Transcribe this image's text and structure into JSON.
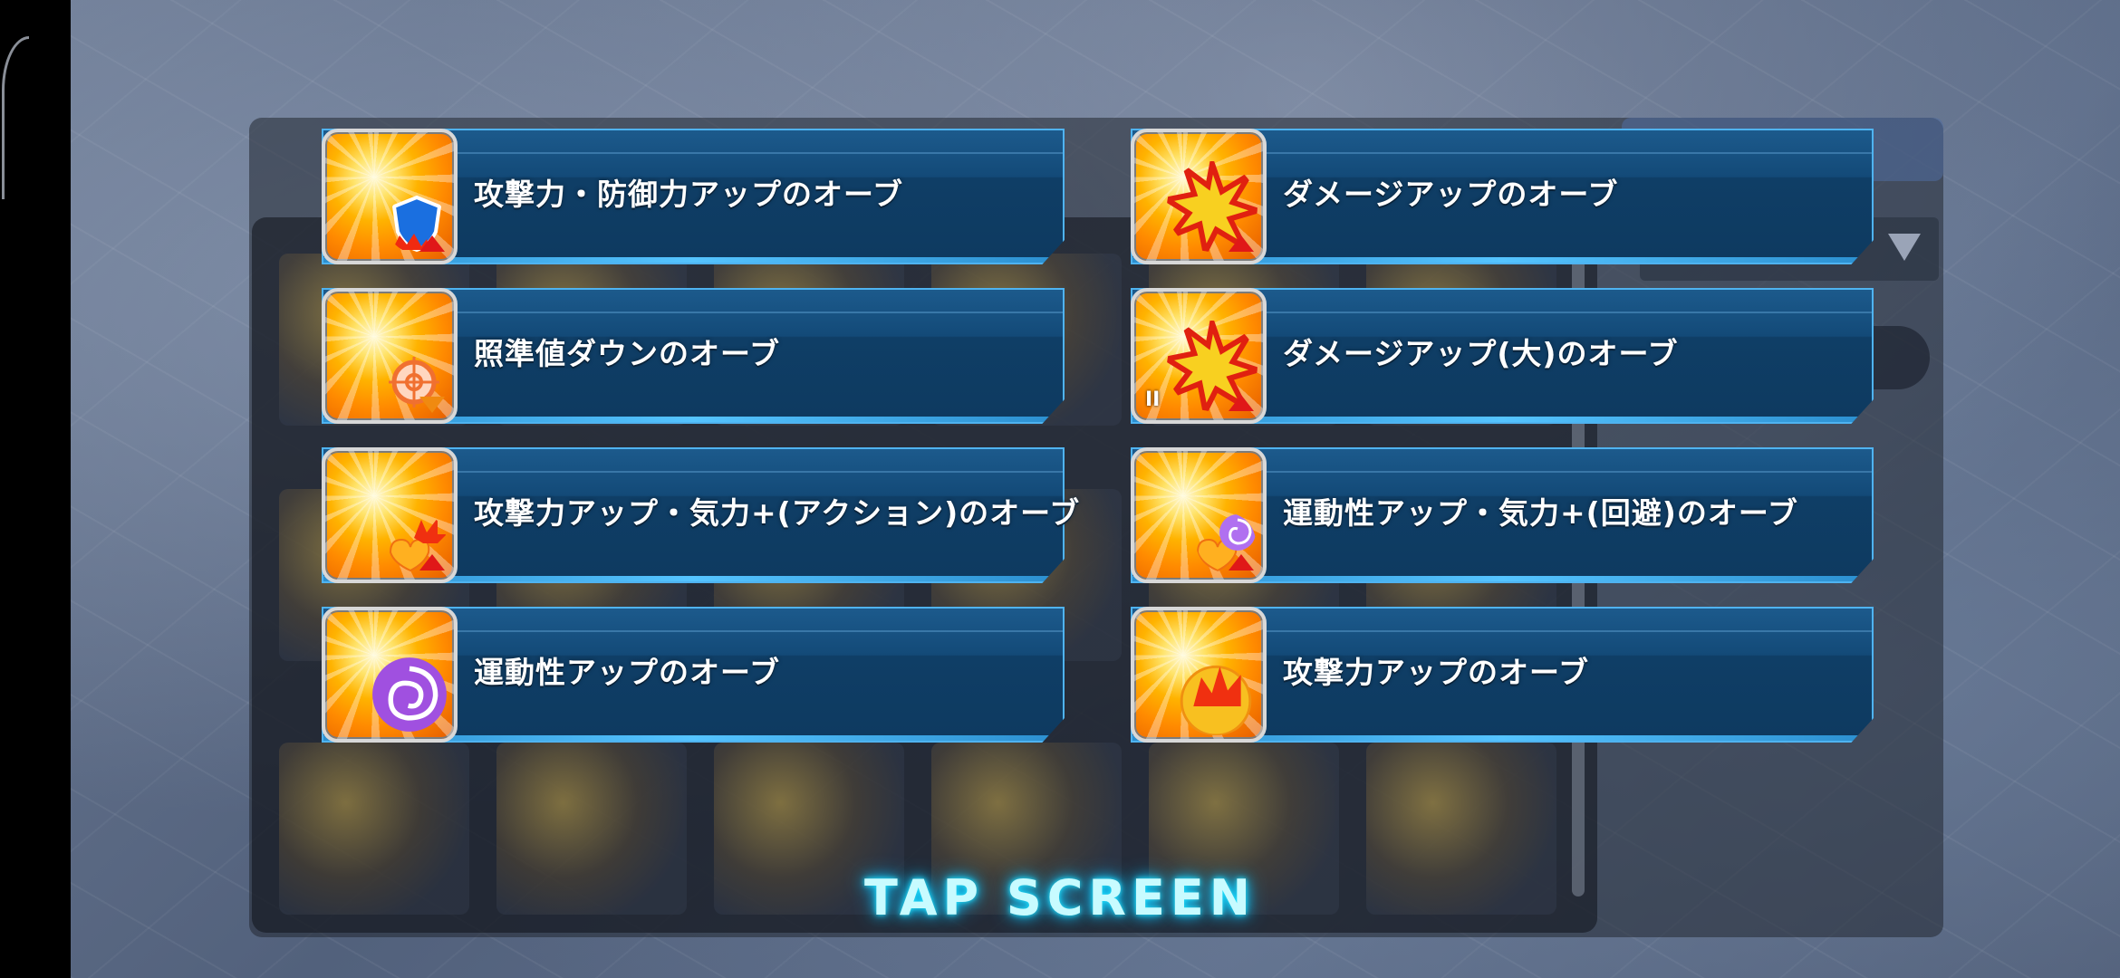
{
  "orbs": [
    {
      "label": "攻撃力・防御力アップのオーブ",
      "icon": "attack-defense-up-orb-icon"
    },
    {
      "label": "ダメージアップのオーブ",
      "icon": "damage-up-orb-icon"
    },
    {
      "label": "照準値ダウンのオーブ",
      "icon": "aim-down-orb-icon"
    },
    {
      "label": "ダメージアップ(大)のオーブ",
      "icon": "damage-up-large-orb-icon",
      "level": "II"
    },
    {
      "label": "攻撃力アップ・気力+(アクション)のオーブ",
      "icon": "attack-up-morale-action-orb-icon"
    },
    {
      "label": "運動性アップ・気力+(回避)のオーブ",
      "icon": "mobility-up-morale-evasion-orb-icon"
    },
    {
      "label": "運動性アップのオーブ",
      "icon": "mobility-up-orb-icon"
    },
    {
      "label": "攻撃力アップのオーブ",
      "icon": "attack-up-orb-icon"
    }
  ],
  "prompt": "TAP SCREEN",
  "colors": {
    "bar": "#134a78",
    "bar_border": "#4fb3f0",
    "prompt_glow": "#22e6ff"
  }
}
